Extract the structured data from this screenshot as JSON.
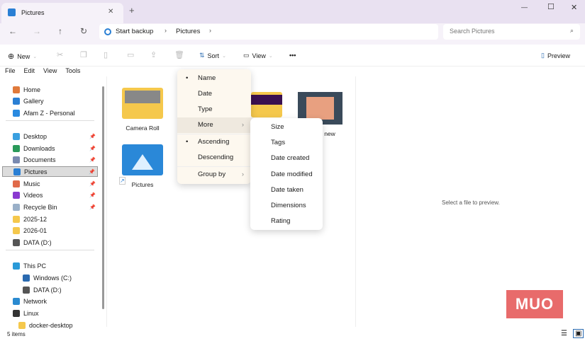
{
  "window": {
    "tab_title": "Pictures",
    "new_tab": "+",
    "close": "✕",
    "minimize": "—",
    "maximize": "☐",
    "close_window": "✕"
  },
  "nav": {
    "back": "←",
    "forward": "→",
    "up": "↑",
    "refresh": "↻"
  },
  "breadcrumb": {
    "items": [
      "Start backup",
      "Pictures"
    ]
  },
  "search": {
    "placeholder": "Search Pictures"
  },
  "toolbar": {
    "new": "New",
    "sort": "Sort",
    "view": "View",
    "more": "•••",
    "preview": "Preview"
  },
  "menubar": [
    "File",
    "Edit",
    "View",
    "Tools"
  ],
  "sidebar": {
    "items": [
      {
        "label": "Home",
        "color": "#e07a3b"
      },
      {
        "label": "Gallery",
        "color": "#2a7fd4"
      },
      {
        "label": "Afam Z - Personal",
        "color": "#2a8ae0"
      },
      {
        "label": "Desktop",
        "color": "#3aa0e0",
        "pin": true
      },
      {
        "label": "Downloads",
        "color": "#2a9a5a",
        "pin": true
      },
      {
        "label": "Documents",
        "color": "#7a8ab0",
        "pin": true
      },
      {
        "label": "Pictures",
        "color": "#2a7fd4",
        "pin": true
      },
      {
        "label": "Music",
        "color": "#e06a4a",
        "pin": true
      },
      {
        "label": "Videos",
        "color": "#8a3ad0",
        "pin": true
      },
      {
        "label": "Recycle Bin",
        "color": "#9ab0c8",
        "pin": true
      },
      {
        "label": "2025-12",
        "color": "#f5c84c"
      },
      {
        "label": "2026-01",
        "color": "#f5c84c"
      },
      {
        "label": "DATA (D:)",
        "color": "#555"
      },
      {
        "label": "This PC",
        "color": "#2a9ad8"
      },
      {
        "label": "Windows (C:)",
        "color": "#2a6ab0"
      },
      {
        "label": "DATA (D:)",
        "color": "#555"
      },
      {
        "label": "Network",
        "color": "#2a8ad0"
      },
      {
        "label": "Linux",
        "color": "#333"
      },
      {
        "label": "docker-desktop",
        "color": "#f5c84c"
      }
    ]
  },
  "files": [
    {
      "name": "Camera Roll"
    },
    {
      "name": "new"
    },
    {
      "name": "Pictures"
    }
  ],
  "sort_menu": {
    "items": [
      "Name",
      "Date",
      "Type",
      "More",
      "Ascending",
      "Descending",
      "Group by"
    ]
  },
  "more_menu": {
    "items": [
      "Size",
      "Tags",
      "Date created",
      "Date modified",
      "Date taken",
      "Dimensions",
      "Rating"
    ]
  },
  "preview_pane": {
    "message": "Select a file to preview."
  },
  "status": {
    "count": "5 items"
  },
  "watermark": "MUO"
}
